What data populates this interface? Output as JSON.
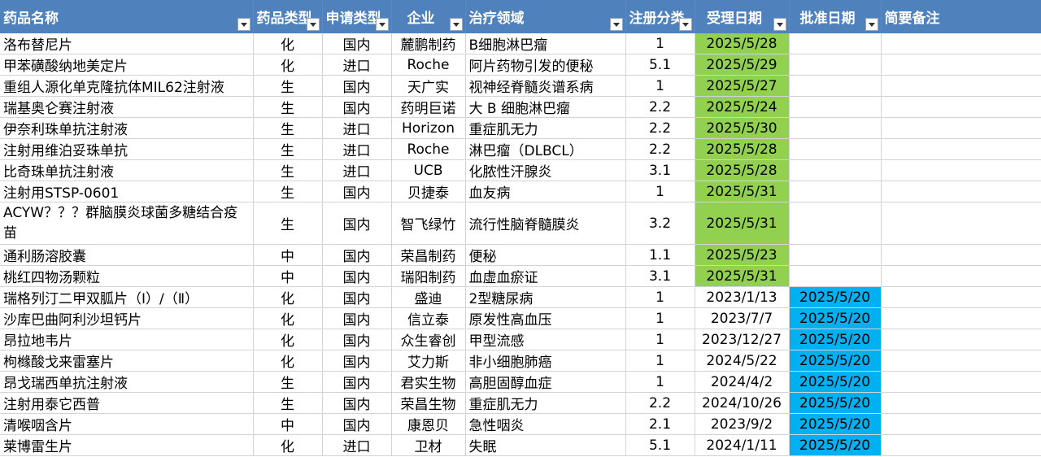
{
  "headers": [
    "药品名称",
    "药品类型",
    "申请类型",
    "企业",
    "治疗领域",
    "注册分类",
    "受理日期",
    "批准日期",
    "简要备注"
  ],
  "colors": {
    "header_bg": "#4f81bd",
    "accept_highlight": "#92d050",
    "approve_highlight": "#00b0f0"
  },
  "rows": [
    {
      "name": "洛布替尼片",
      "type": "化",
      "app": "国内",
      "company": "麓鹏制药",
      "area": "B细胞淋巴瘤",
      "cls": "1",
      "accept": "2025/5/28",
      "approve": "",
      "note": ""
    },
    {
      "name": "甲苯磺酸纳地美定片",
      "type": "化",
      "app": "进口",
      "company": "Roche",
      "area": "阿片药物引发的便秘",
      "cls": "5.1",
      "accept": "2025/5/29",
      "approve": "",
      "note": ""
    },
    {
      "name": "重组人源化单克隆抗体MIL62注射液",
      "type": "生",
      "app": "国内",
      "company": "天广实",
      "area": "视神经脊髓炎谱系病",
      "cls": "1",
      "accept": "2025/5/27",
      "approve": "",
      "note": ""
    },
    {
      "name": "瑞基奥仑赛注射液",
      "type": "生",
      "app": "国内",
      "company": "药明巨诺",
      "area": "大 B 细胞淋巴瘤",
      "cls": "2.2",
      "accept": "2025/5/24",
      "approve": "",
      "note": ""
    },
    {
      "name": "伊奈利珠单抗注射液",
      "type": "生",
      "app": "进口",
      "company": "Horizon",
      "area": "重症肌无力",
      "cls": "2.2",
      "accept": "2025/5/30",
      "approve": "",
      "note": ""
    },
    {
      "name": "注射用维泊妥珠单抗",
      "type": "生",
      "app": "进口",
      "company": "Roche",
      "area": "淋巴瘤（DLBCL）",
      "cls": "2.2",
      "accept": "2025/5/28",
      "approve": "",
      "note": ""
    },
    {
      "name": "比奇珠单抗注射液",
      "type": "生",
      "app": "进口",
      "company": "UCB",
      "area": "化脓性汗腺炎",
      "cls": "3.1",
      "accept": "2025/5/28",
      "approve": "",
      "note": ""
    },
    {
      "name": "注射用STSP-0601",
      "type": "生",
      "app": "国内",
      "company": "贝捷泰",
      "area": "血友病",
      "cls": "1",
      "accept": "2025/5/31",
      "approve": "",
      "note": ""
    },
    {
      "name": "ACYW？？？群脑膜炎球菌多糖结合疫苗",
      "type": "生",
      "app": "国内",
      "company": "智飞绿竹",
      "area": "流行性脑脊髓膜炎",
      "cls": "3.2",
      "accept": "2025/5/31",
      "approve": "",
      "note": ""
    },
    {
      "name": "通利肠溶胶囊",
      "type": "中",
      "app": "国内",
      "company": "荣昌制药",
      "area": "便秘",
      "cls": "1.1",
      "accept": "2025/5/23",
      "approve": "",
      "note": ""
    },
    {
      "name": "桃红四物汤颗粒",
      "type": "中",
      "app": "国内",
      "company": "瑞阳制药",
      "area": "血虚血瘀证",
      "cls": "3.1",
      "accept": "2025/5/31",
      "approve": "",
      "note": ""
    },
    {
      "name": "瑞格列汀二甲双胍片（Ⅰ）/（Ⅱ）",
      "type": "化",
      "app": "国内",
      "company": "盛迪",
      "area": "2型糖尿病",
      "cls": "1",
      "accept": "2023/1/13",
      "approve": "2025/5/20",
      "note": ""
    },
    {
      "name": "沙库巴曲阿利沙坦钙片",
      "type": "化",
      "app": "国内",
      "company": "信立泰",
      "area": "原发性高血压",
      "cls": "1",
      "accept": "2023/7/7",
      "approve": "2025/5/20",
      "note": ""
    },
    {
      "name": "昂拉地韦片",
      "type": "化",
      "app": "国内",
      "company": "众生睿创",
      "area": "甲型流感",
      "cls": "1",
      "accept": "2023/12/27",
      "approve": "2025/5/20",
      "note": ""
    },
    {
      "name": "枸橼酸戈来雷塞片",
      "type": "化",
      "app": "国内",
      "company": "艾力斯",
      "area": "非小细胞肺癌",
      "cls": "1",
      "accept": "2024/5/22",
      "approve": "2025/5/20",
      "note": ""
    },
    {
      "name": "昂戈瑞西单抗注射液",
      "type": "生",
      "app": "国内",
      "company": "君实生物",
      "area": "高胆固醇血症",
      "cls": "1",
      "accept": "2024/4/2",
      "approve": "2025/5/20",
      "note": ""
    },
    {
      "name": "注射用泰它西普",
      "type": "生",
      "app": "国内",
      "company": "荣昌生物",
      "area": "重症肌无力",
      "cls": "2.2",
      "accept": "2024/10/26",
      "approve": "2025/5/20",
      "note": ""
    },
    {
      "name": "清喉咽含片",
      "type": "中",
      "app": "国内",
      "company": "康恩贝",
      "area": "急性咽炎",
      "cls": "2.1",
      "accept": "2023/9/2",
      "approve": "2025/5/20",
      "note": ""
    },
    {
      "name": "莱博雷生片",
      "type": "化",
      "app": "进口",
      "company": "卫材",
      "area": "失眠",
      "cls": "5.1",
      "accept": "2024/1/11",
      "approve": "2025/5/20",
      "note": ""
    }
  ]
}
